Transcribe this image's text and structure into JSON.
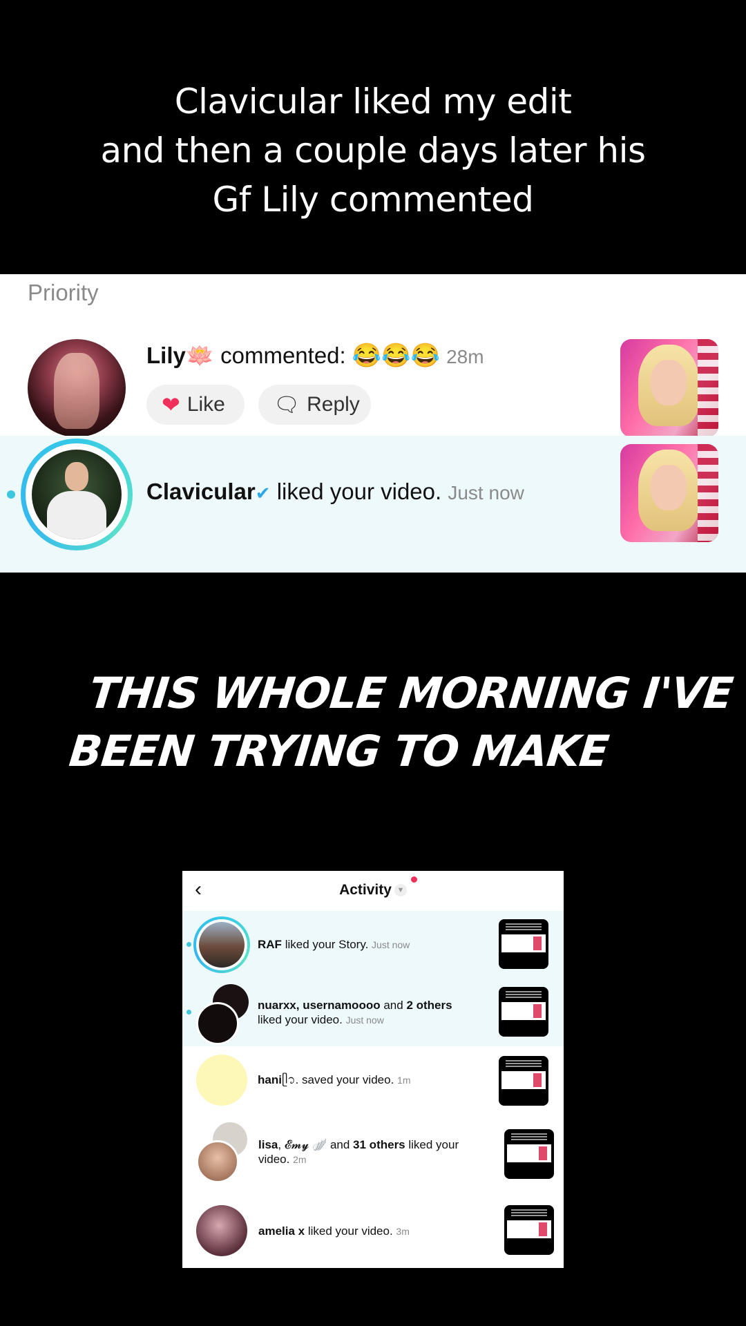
{
  "caption": {
    "line1": "Clavicular liked my edit",
    "line2": "and then a couple days later his",
    "line3": "Gf  Lily commented"
  },
  "notifications": {
    "section_label": "Priority",
    "comment": {
      "user": "Lily",
      "user_emoji": "🪷",
      "action": "commented:",
      "emojis": "😂😂😂",
      "time": "28m",
      "like_label": "Like",
      "reply_label": "Reply"
    },
    "like": {
      "user": "Clavicular",
      "verified_icon": "verified-badge-icon",
      "action": "liked your video.",
      "time": "Just now"
    }
  },
  "overlay_text": {
    "line1": "THIS WHOLE MORNING I'VE",
    "line2": "BEEN TRYING TO MAKE"
  },
  "activity": {
    "title": "Activity",
    "back_icon": "chevron-left-icon",
    "items": [
      {
        "name": "RAF",
        "text": "liked your Story.",
        "time": "Just now"
      },
      {
        "name": "nuarxx, usernamoooo",
        "mid": "and",
        "count": "2 others",
        "text": "liked your video.",
        "time": "Just now"
      },
      {
        "name": "hani",
        "name_suffix": "ᥫ᭡.",
        "text": "saved your video.",
        "time": "1m"
      },
      {
        "name": "lisa",
        "name2": "𝓔𝓶𝔂 🪽",
        "mid": "and",
        "count": "31 others",
        "text": "liked your",
        "text2": "video.",
        "time": "2m"
      },
      {
        "name": "amelia x",
        "text": "liked your video.",
        "time": "3m"
      }
    ]
  },
  "colors": {
    "highlight_bg": "#eef9fc",
    "ring": "#35c9e8",
    "like_heart": "#f0305a",
    "unread_dot": "#3ec7de"
  }
}
